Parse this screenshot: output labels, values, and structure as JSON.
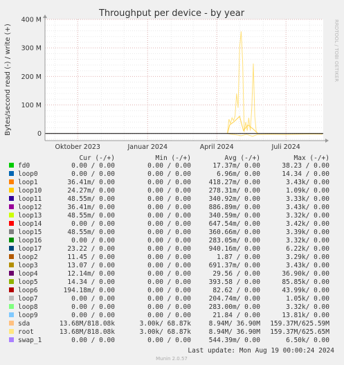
{
  "chart_data": {
    "type": "line",
    "title": "Throughput per device - by year",
    "ylabel": "Bytes/second read (-) / write (+)",
    "side_label": "RRDTOOL / TOBI OETIKER",
    "ylim": [
      -25000000,
      400000000
    ],
    "y_ticks": [
      {
        "value": 0,
        "label": "0"
      },
      {
        "value": 100000000,
        "label": "100 M"
      },
      {
        "value": 200000000,
        "label": "200 M"
      },
      {
        "value": 300000000,
        "label": "300 M"
      },
      {
        "value": 400000000,
        "label": "400 M"
      }
    ],
    "x_range": [
      "2023-08-19",
      "2024-08-19"
    ],
    "x_ticks": [
      {
        "date": "2023-10-01",
        "label": "Oktober 2023"
      },
      {
        "date": "2024-01-01",
        "label": "Januar 2024"
      },
      {
        "date": "2024-04-01",
        "label": "April 2024"
      },
      {
        "date": "2024-07-01",
        "label": "Juli 2024"
      }
    ],
    "grid": true,
    "series": [
      {
        "name": "sda",
        "color": "#ffe07a",
        "write_points": [
          [
            "2024-04-15",
            0
          ],
          [
            "2024-04-17",
            50000000
          ],
          [
            "2024-04-19",
            35000000
          ],
          [
            "2024-04-21",
            55000000
          ],
          [
            "2024-04-23",
            45000000
          ],
          [
            "2024-04-25",
            60000000
          ],
          [
            "2024-04-27",
            140000000
          ],
          [
            "2024-04-29",
            90000000
          ],
          [
            "2024-05-01",
            300000000
          ],
          [
            "2024-05-03",
            358000000
          ],
          [
            "2024-05-05",
            250000000
          ],
          [
            "2024-05-07",
            5000000
          ],
          [
            "2024-05-09",
            40000000
          ],
          [
            "2024-05-11",
            10000000
          ],
          [
            "2024-05-13",
            55000000
          ],
          [
            "2024-05-15",
            10000000
          ],
          [
            "2024-05-17",
            90000000
          ],
          [
            "2024-05-19",
            245000000
          ],
          [
            "2024-05-21",
            60000000
          ],
          [
            "2024-05-23",
            5000000
          ],
          [
            "2024-05-25",
            0
          ]
        ],
        "read_points": [
          [
            "2024-04-15",
            0
          ],
          [
            "2024-04-20",
            -3000000
          ],
          [
            "2024-04-27",
            -5000000
          ],
          [
            "2024-05-03",
            -8000000
          ],
          [
            "2024-05-10",
            -3000000
          ],
          [
            "2024-05-18",
            -10000000
          ],
          [
            "2024-05-24",
            -4000000
          ],
          [
            "2024-06-10",
            -3000000
          ],
          [
            "2024-07-01",
            -4000000
          ],
          [
            "2024-08-01",
            -2000000
          ],
          [
            "2024-08-18",
            -3000000
          ]
        ]
      },
      {
        "name": "root",
        "color": "#ffd24a",
        "write_points": [
          [
            "2024-04-15",
            0
          ],
          [
            "2024-04-18",
            30000000
          ],
          [
            "2024-04-24",
            42000000
          ],
          [
            "2024-05-01",
            60000000
          ],
          [
            "2024-05-06",
            10000000
          ],
          [
            "2024-05-12",
            30000000
          ],
          [
            "2024-05-19",
            15000000
          ],
          [
            "2024-05-25",
            0
          ]
        ],
        "read_points": []
      }
    ],
    "columns": [
      "Cur (-/+)",
      "Min (-/+)",
      "Avg (-/+)",
      "Max (-/+)"
    ],
    "rows": [
      {
        "name": "fd0",
        "color": "#00cc00",
        "cur": " 0.00 /  0.00",
        "min": " 0.00 /  0.00",
        "avg": "17.37m/  0.00",
        "max": "38.23 /  0.00"
      },
      {
        "name": "loop0",
        "color": "#0066b3",
        "cur": " 0.00 /  0.00",
        "min": " 0.00 /  0.00",
        "avg": " 6.96m/  0.00",
        "max": "14.34 /  0.00"
      },
      {
        "name": "loop1",
        "color": "#ff8000",
        "cur": "36.41m/  0.00",
        "min": " 0.00 /  0.00",
        "avg": "418.27m/  0.00",
        "max": " 3.43k/  0.00"
      },
      {
        "name": "loop10",
        "color": "#ffcc00",
        "cur": "24.27m/  0.00",
        "min": " 0.00 /  0.00",
        "avg": "278.31m/  0.00",
        "max": " 1.09k/  0.00"
      },
      {
        "name": "loop11",
        "color": "#330099",
        "cur": "48.55m/  0.00",
        "min": " 0.00 /  0.00",
        "avg": "340.92m/  0.00",
        "max": " 3.33k/  0.00"
      },
      {
        "name": "loop12",
        "color": "#990099",
        "cur": "36.41m/  0.00",
        "min": " 0.00 /  0.00",
        "avg": "886.89m/  0.00",
        "max": " 3.43k/  0.00"
      },
      {
        "name": "loop13",
        "color": "#ccff00",
        "cur": "48.55m/  0.00",
        "min": " 0.00 /  0.00",
        "avg": "340.59m/  0.00",
        "max": " 3.32k/  0.00"
      },
      {
        "name": "loop14",
        "color": "#ff0000",
        "cur": " 0.00 /  0.00",
        "min": " 0.00 /  0.00",
        "avg": "647.54m/  0.00",
        "max": " 3.42k/  0.00"
      },
      {
        "name": "loop15",
        "color": "#808080",
        "cur": "48.55m/  0.00",
        "min": " 0.00 /  0.00",
        "avg": "360.66m/  0.00",
        "max": " 3.39k/  0.00"
      },
      {
        "name": "loop16",
        "color": "#008f00",
        "cur": " 0.00 /  0.00",
        "min": " 0.00 /  0.00",
        "avg": "283.05m/  0.00",
        "max": " 3.32k/  0.00"
      },
      {
        "name": "loop17",
        "color": "#00487d",
        "cur": "23.22 /  0.00",
        "min": " 0.00 /  0.00",
        "avg": "940.16m/  0.00",
        "max": " 6.22k/  0.00"
      },
      {
        "name": "loop2",
        "color": "#b35a00",
        "cur": "11.45 /  0.00",
        "min": " 0.00 /  0.00",
        "avg": " 1.87 /  0.00",
        "max": " 3.29k/  0.00"
      },
      {
        "name": "loop3",
        "color": "#b38f00",
        "cur": "13.07 /  0.00",
        "min": " 0.00 /  0.00",
        "avg": "691.37m/  0.00",
        "max": " 3.43k/  0.00"
      },
      {
        "name": "loop4",
        "color": "#6b006b",
        "cur": "12.14m/  0.00",
        "min": " 0.00 /  0.00",
        "avg": "29.56 /  0.00",
        "max": "36.90k/  0.00"
      },
      {
        "name": "loop5",
        "color": "#8fb300",
        "cur": "14.34 /  0.00",
        "min": " 0.00 /  0.00",
        "avg": "393.58 /  0.00",
        "max": "85.85k/  0.00"
      },
      {
        "name": "loop6",
        "color": "#b30000",
        "cur": "194.18m/  0.00",
        "min": " 0.00 /  0.00",
        "avg": "82.62 /  0.00",
        "max": "43.99k/  0.00"
      },
      {
        "name": "loop7",
        "color": "#bebebe",
        "cur": " 0.00 /  0.00",
        "min": " 0.00 /  0.00",
        "avg": "204.74m/  0.00",
        "max": " 1.05k/  0.00"
      },
      {
        "name": "loop8",
        "color": "#80ff80",
        "cur": " 0.00 /  0.00",
        "min": " 0.00 /  0.00",
        "avg": "283.00m/  0.00",
        "max": " 3.32k/  0.00"
      },
      {
        "name": "loop9",
        "color": "#80c9ff",
        "cur": " 0.00 /  0.00",
        "min": " 0.00 /  0.00",
        "avg": "21.84 /  0.00",
        "max": "13.81k/  0.00"
      },
      {
        "name": "sda",
        "color": "#ffc080",
        "cur": "13.68M/818.08k",
        "min": "3.00k/ 68.87k",
        "avg": " 8.94M/ 36.90M",
        "max": "159.37M/625.59M"
      },
      {
        "name": "root",
        "color": "#ffe680",
        "cur": "13.68M/818.08k",
        "min": "3.00k/ 68.87k",
        "avg": " 8.94M/ 36.90M",
        "max": "159.37M/625.65M"
      },
      {
        "name": "swap_1",
        "color": "#aa80ff",
        "cur": " 0.00 /  0.00",
        "min": " 0.00 /  0.00",
        "avg": "544.39m/  0.00",
        "max": " 6.50k/  0.00"
      }
    ],
    "last_update": "Last update: Mon Aug 19 00:00:24 2024",
    "footer": "Munin 2.0.57"
  },
  "colors": {
    "background": "#f0f0f0",
    "plot_background": "#ffffff",
    "grid_major": "#e0b0b0",
    "grid_minor": "#e8e8e8",
    "zero_line": "#000000"
  }
}
